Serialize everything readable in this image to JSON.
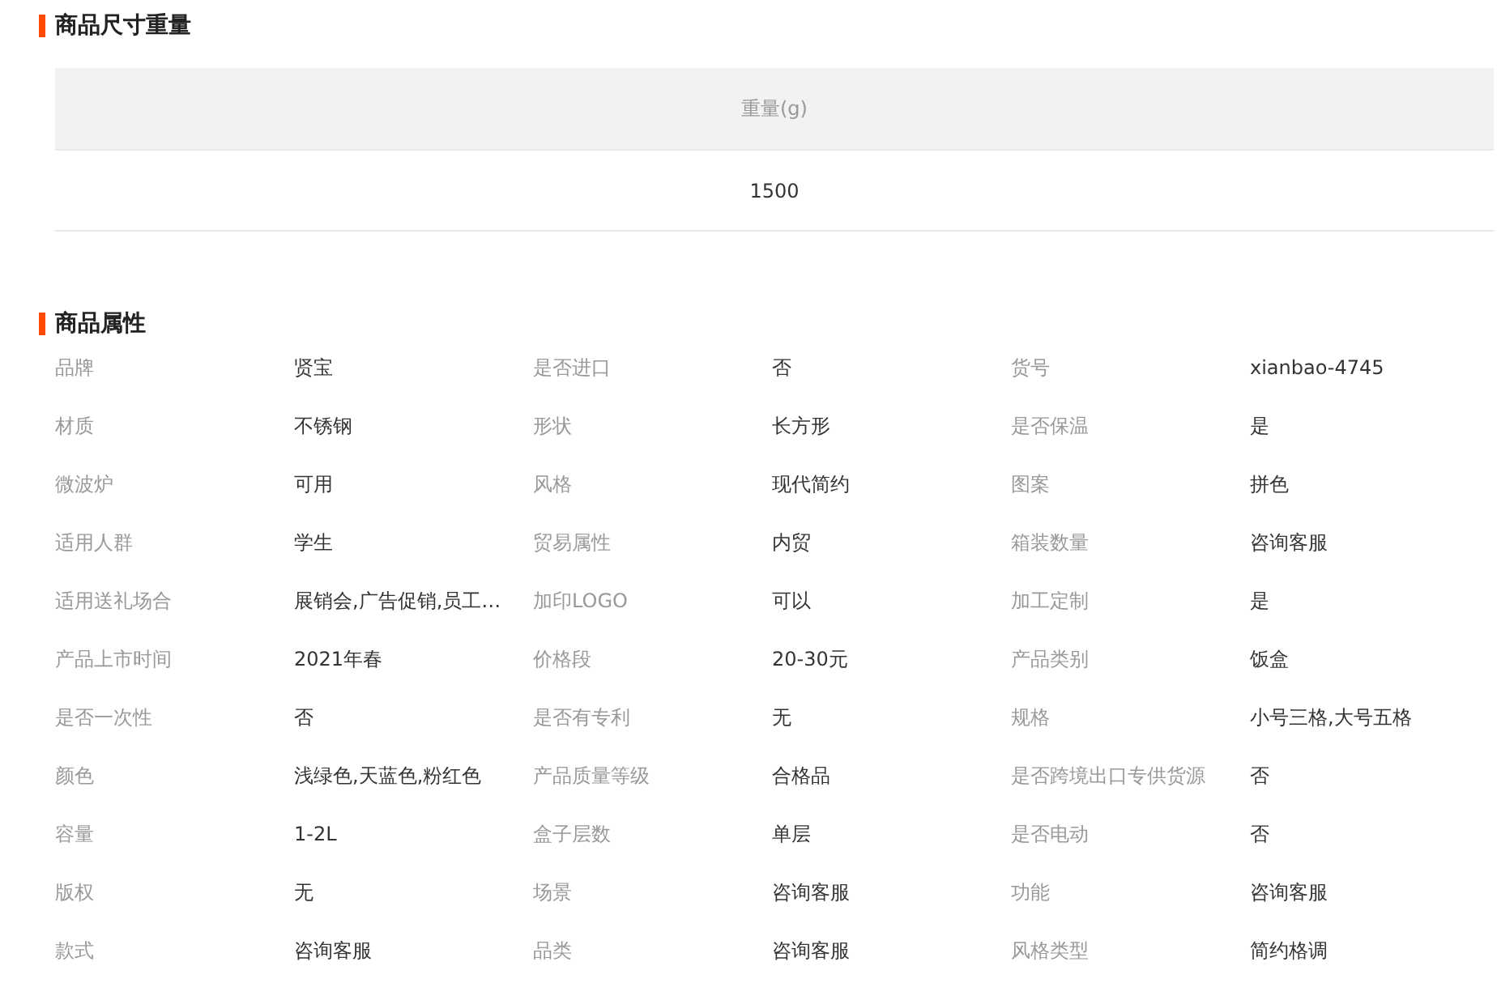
{
  "size_section": {
    "title": "商品尺寸重量",
    "columns": [
      "重量(g)"
    ],
    "rows": [
      [
        "1500"
      ]
    ]
  },
  "attributes_section": {
    "title": "商品属性",
    "items": [
      {
        "label": "品牌",
        "value": "贤宝"
      },
      {
        "label": "是否进口",
        "value": "否"
      },
      {
        "label": "货号",
        "value": "xianbao-4745"
      },
      {
        "label": "材质",
        "value": "不锈钢"
      },
      {
        "label": "形状",
        "value": "长方形"
      },
      {
        "label": "是否保温",
        "value": "是"
      },
      {
        "label": "微波炉",
        "value": "可用"
      },
      {
        "label": "风格",
        "value": "现代简约"
      },
      {
        "label": "图案",
        "value": "拼色"
      },
      {
        "label": "适用人群",
        "value": "学生"
      },
      {
        "label": "贸易属性",
        "value": "内贸"
      },
      {
        "label": "箱装数量",
        "value": "咨询客服"
      },
      {
        "label": "适用送礼场合",
        "value": "展销会,广告促销,员工…"
      },
      {
        "label": "加印LOGO",
        "value": "可以"
      },
      {
        "label": "加工定制",
        "value": "是"
      },
      {
        "label": "产品上市时间",
        "value": "2021年春"
      },
      {
        "label": "价格段",
        "value": "20-30元"
      },
      {
        "label": "产品类别",
        "value": "饭盒"
      },
      {
        "label": "是否一次性",
        "value": "否"
      },
      {
        "label": "是否有专利",
        "value": "无"
      },
      {
        "label": "规格",
        "value": "小号三格,大号五格"
      },
      {
        "label": "颜色",
        "value": "浅绿色,天蓝色,粉红色"
      },
      {
        "label": "产品质量等级",
        "value": "合格品"
      },
      {
        "label": "是否跨境出口专供货源",
        "value": "否"
      },
      {
        "label": "容量",
        "value": "1-2L"
      },
      {
        "label": "盒子层数",
        "value": "单层"
      },
      {
        "label": "是否电动",
        "value": "否"
      },
      {
        "label": "版权",
        "value": "无"
      },
      {
        "label": "场景",
        "value": "咨询客服"
      },
      {
        "label": "功能",
        "value": "咨询客服"
      },
      {
        "label": "款式",
        "value": "咨询客服"
      },
      {
        "label": "品类",
        "value": "咨询客服"
      },
      {
        "label": "风格类型",
        "value": "简约格调"
      }
    ]
  }
}
